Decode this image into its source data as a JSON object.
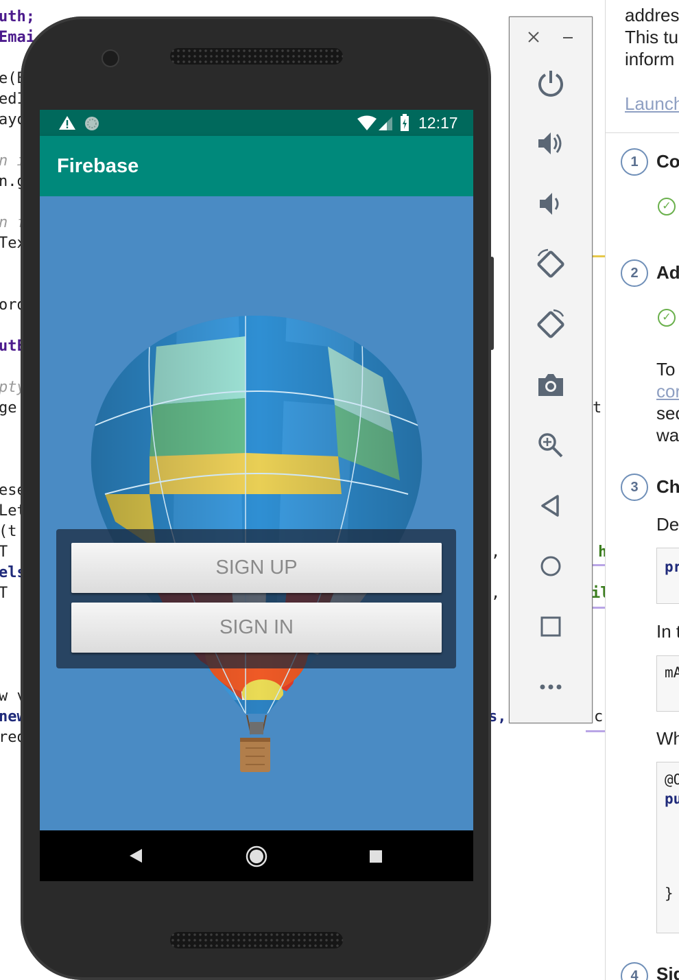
{
  "code_editor": {
    "lines": [
      {
        "text": "uth;",
        "cls": "kw"
      },
      {
        "text": "Emai",
        "cls": "kw"
      },
      {
        "text": "e(B",
        "cls": ""
      },
      {
        "text": "edI",
        "cls": ""
      },
      {
        "text": "ayo",
        "cls": ""
      },
      {
        "text": "n i",
        "cls": "cm"
      },
      {
        "text": "n.g",
        "cls": ""
      },
      {
        "text": "n f",
        "cls": "cm"
      },
      {
        "text": "Tex",
        "cls": ""
      },
      {
        "text": "ord",
        "cls": ""
      },
      {
        "text": "utE",
        "cls": "kw"
      },
      {
        "text": "pty",
        "cls": "cm"
      },
      {
        "text": "ge",
        "cls": ""
      },
      {
        "text": "ese",
        "cls": ""
      },
      {
        "text": "Let",
        "cls": ""
      },
      {
        "text": "(t",
        "cls": ""
      },
      {
        "text": "T",
        "cls": ""
      },
      {
        "text": "els",
        "cls": "nv"
      },
      {
        "text": "T",
        "cls": ""
      },
      {
        "text": "w v",
        "cls": ""
      },
      {
        "text": "new",
        "cls": "nv"
      },
      {
        "text": "red",
        "cls": ""
      }
    ],
    "right_fragments": [
      {
        "text": "t.",
        "cls": ""
      },
      {
        "text": ",",
        "cls": ""
      },
      {
        "text": "h",
        "cls": "gr"
      },
      {
        "text": ",",
        "cls": ""
      },
      {
        "text": "il",
        "cls": "gr"
      },
      {
        "text": "s,",
        "cls": "nv"
      },
      {
        "text": "c",
        "cls": ""
      }
    ]
  },
  "phone": {
    "status_time": "12:17",
    "app_title": "Firebase",
    "buttons": {
      "sign_up": "SIGN UP",
      "sign_in": "SIGN IN"
    }
  },
  "emulator_toolbar": {
    "icons": [
      "close-icon",
      "minimize-icon",
      "power-icon",
      "volume-up-icon",
      "volume-down-icon",
      "rotate-left-icon",
      "rotate-right-icon",
      "camera-icon",
      "zoom-icon",
      "back-icon",
      "home-icon",
      "overview-icon",
      "more-icon"
    ]
  },
  "help_panel": {
    "intro_lines": [
      "addres",
      "This tu",
      "inform"
    ],
    "launch_link": "Launch",
    "steps": [
      {
        "num": "1",
        "title": "Co"
      },
      {
        "num": "2",
        "title": "Ad"
      },
      {
        "num": "3",
        "title": "Ch"
      },
      {
        "num": "4",
        "title": "Sig"
      }
    ],
    "step2_text": [
      "To",
      "cor",
      "sec",
      "wa"
    ],
    "step2_link_index": 1,
    "step3_text": {
      "de": "De",
      "in": "In t",
      "wh": "Wh"
    },
    "code_snippets": {
      "pr": "pr",
      "ma": "mA",
      "oc": "@O",
      "pu": "pu",
      "brace": "}"
    }
  },
  "colors": {
    "status_bar": "#00695c",
    "app_bar": "#00897b",
    "sky": "#4a8bc4",
    "accent_link": "#8e9fc2",
    "check_green": "#6ab04c"
  }
}
